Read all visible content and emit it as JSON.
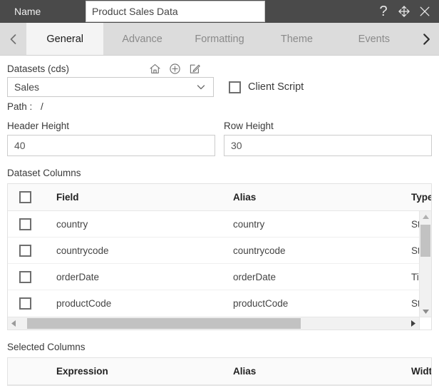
{
  "titlebar": {
    "name_label": "Name",
    "name_value": "Product Sales Data",
    "name_placeholder": "Name",
    "help_icon": "question-mark-icon",
    "move_icon": "move-arrows-icon",
    "close_icon": "close-x-icon"
  },
  "tabbar": {
    "prev_icon": "chevron-left-icon",
    "next_icon": "chevron-right-icon",
    "tabs": [
      {
        "label": "General",
        "active": true
      },
      {
        "label": "Advance",
        "active": false
      },
      {
        "label": "Formatting",
        "active": false
      },
      {
        "label": "Theme",
        "active": false
      },
      {
        "label": "Events",
        "active": false
      }
    ]
  },
  "general": {
    "datasets_label": "Datasets (cds)",
    "datasets_icons": [
      {
        "name": "home-icon"
      },
      {
        "name": "add-circle-icon"
      },
      {
        "name": "edit-pencil-icon"
      }
    ],
    "dataset_selected": "Sales",
    "dataset_options": [
      "Sales"
    ],
    "dropdown_caret_icon": "chevron-down-icon",
    "client_script_label": "Client Script",
    "client_script_checked": false,
    "path_label": "Path :",
    "path_value": "/",
    "header_height_label": "Header Height",
    "header_height_value": "40",
    "row_height_label": "Row Height",
    "row_height_value": "30"
  },
  "dataset_columns": {
    "section_title": "Dataset Columns",
    "headers": {
      "check": "",
      "field": "Field",
      "alias": "Alias",
      "type": "Type"
    },
    "rows": [
      {
        "checked": false,
        "field": "country",
        "alias": "country",
        "type": "St"
      },
      {
        "checked": false,
        "field": "countrycode",
        "alias": "countrycode",
        "type": "St"
      },
      {
        "checked": false,
        "field": "orderDate",
        "alias": "orderDate",
        "type": "Ti"
      },
      {
        "checked": false,
        "field": "productCode",
        "alias": "productCode",
        "type": "St"
      }
    ],
    "scroll": {
      "up_arrow_icon": "scroll-up-arrow-icon",
      "down_arrow_icon": "scroll-down-arrow-icon",
      "left_arrow_icon": "scroll-left-arrow-icon",
      "right_arrow_icon": "scroll-right-arrow-icon"
    }
  },
  "selected_columns": {
    "section_title": "Selected Columns",
    "headers": {
      "expression": "Expression",
      "alias": "Alias",
      "width": "Widt"
    }
  },
  "colors": {
    "titlebar_bg": "#4a4a4a",
    "tabbar_bg": "#dcdcdc",
    "active_tab_bg": "#f4f4f4",
    "scroll_thumb": "#c2c2c2"
  }
}
